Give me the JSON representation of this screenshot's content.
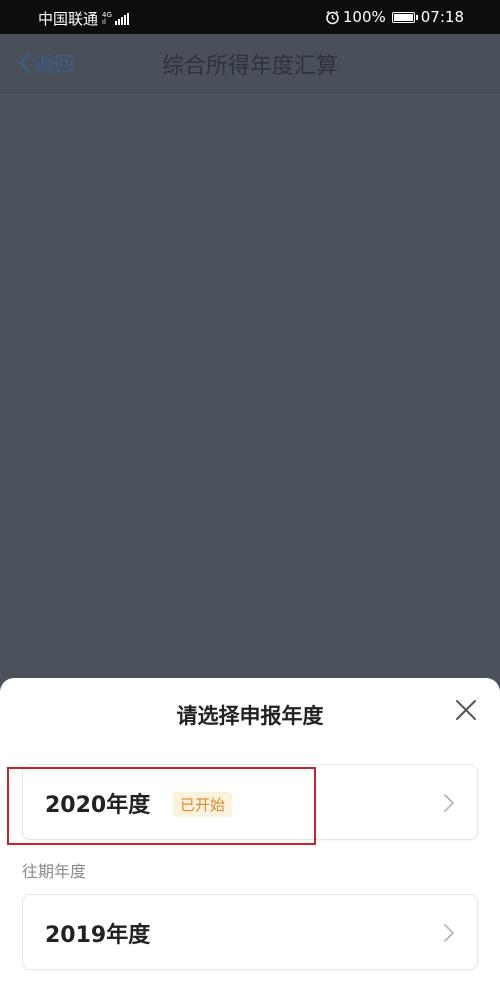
{
  "status_bar": {
    "carrier": "中国联通",
    "network": "4G",
    "battery": "100%",
    "time": "07:18"
  },
  "header": {
    "back_label": "返回",
    "title": "综合所得年度汇算"
  },
  "sheet": {
    "title": "请选择申报年度",
    "current": {
      "label": "2020年度",
      "tag": "已开始"
    },
    "past_section_label": "往期年度",
    "past": [
      {
        "label": "2019年度"
      }
    ]
  },
  "colors": {
    "overlay": "#4b525c",
    "tag_text": "#e08a2a",
    "tag_bg": "#fdf2de",
    "highlight": "#c0262b"
  },
  "icons": [
    "signal-icon",
    "alarm-icon",
    "battery-icon",
    "back-chevron-icon",
    "close-icon",
    "chevron-right-icon"
  ]
}
